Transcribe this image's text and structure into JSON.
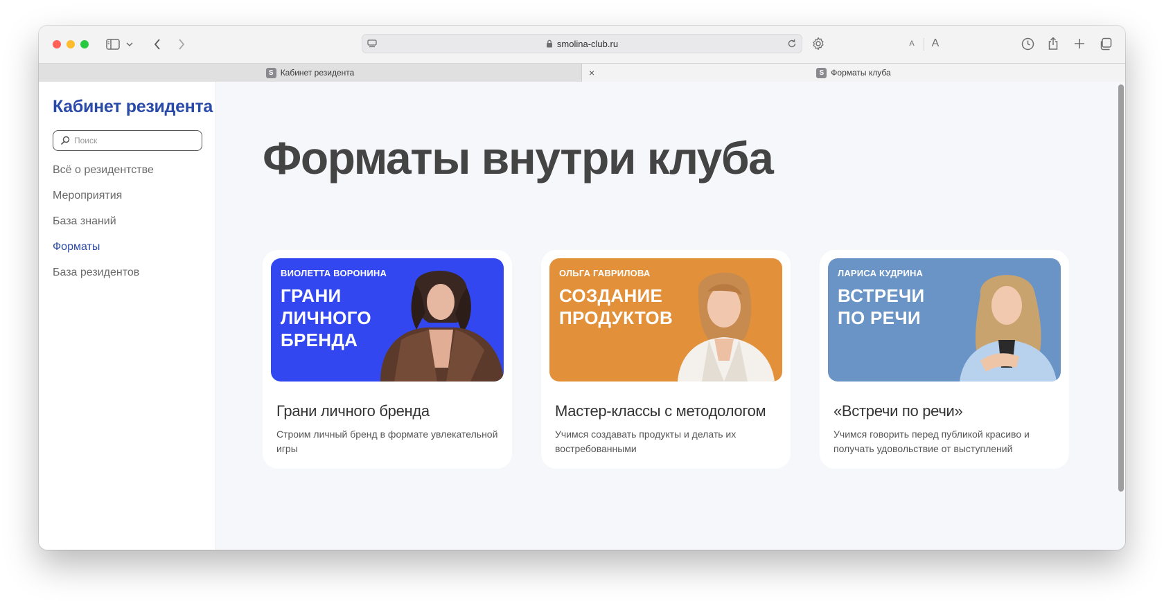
{
  "browser": {
    "url": "smolina-club.ru",
    "tabs": [
      {
        "label": "Кабинет резидента",
        "favicon": "S",
        "active": false
      },
      {
        "label": "Форматы клуба",
        "favicon": "S",
        "active": true
      }
    ],
    "font_small_label": "A",
    "font_large_label": "A",
    "tab_close_label": "×"
  },
  "sidebar": {
    "title": "Кабинет резидента",
    "search_placeholder": "Поиск",
    "items": [
      {
        "label": "Всё о резидентстве",
        "active": false
      },
      {
        "label": "Мероприятия",
        "active": false
      },
      {
        "label": "База знаний",
        "active": false
      },
      {
        "label": "Форматы",
        "active": true
      },
      {
        "label": "База резидентов",
        "active": false
      }
    ]
  },
  "main": {
    "title": "Форматы внутри клуба",
    "cards": [
      {
        "author": "ВИОЛЕТТА ВОРОНИНА",
        "headline": [
          "ГРАНИ",
          "ЛИЧНОГО",
          "БРЕНДА"
        ],
        "title": "Грани личного бренда",
        "description": "Строим личный бренд в формате увлекательной игры",
        "banner_color": "#3347f0"
      },
      {
        "author": "ОЛЬГА ГАВРИЛОВА",
        "headline": [
          "СОЗДАНИЕ",
          "ПРОДУКТОВ"
        ],
        "title": "Мастер-классы с методологом",
        "description": "Учимся создавать продукты и делать их востребованными",
        "banner_color": "#e2913a"
      },
      {
        "author": "ЛАРИСА КУДРИНА",
        "headline": [
          "ВСТРЕЧИ",
          "ПО РЕЧИ"
        ],
        "title": "«Встречи по речи»",
        "description": "Учимся говорить перед публикой красиво и получать удовольствие от выступлений",
        "banner_color": "#6a94c6"
      }
    ]
  },
  "colors": {
    "accent": "#2a4aa8",
    "title_text": "#444444",
    "page_bg": "#f6f7fb"
  }
}
